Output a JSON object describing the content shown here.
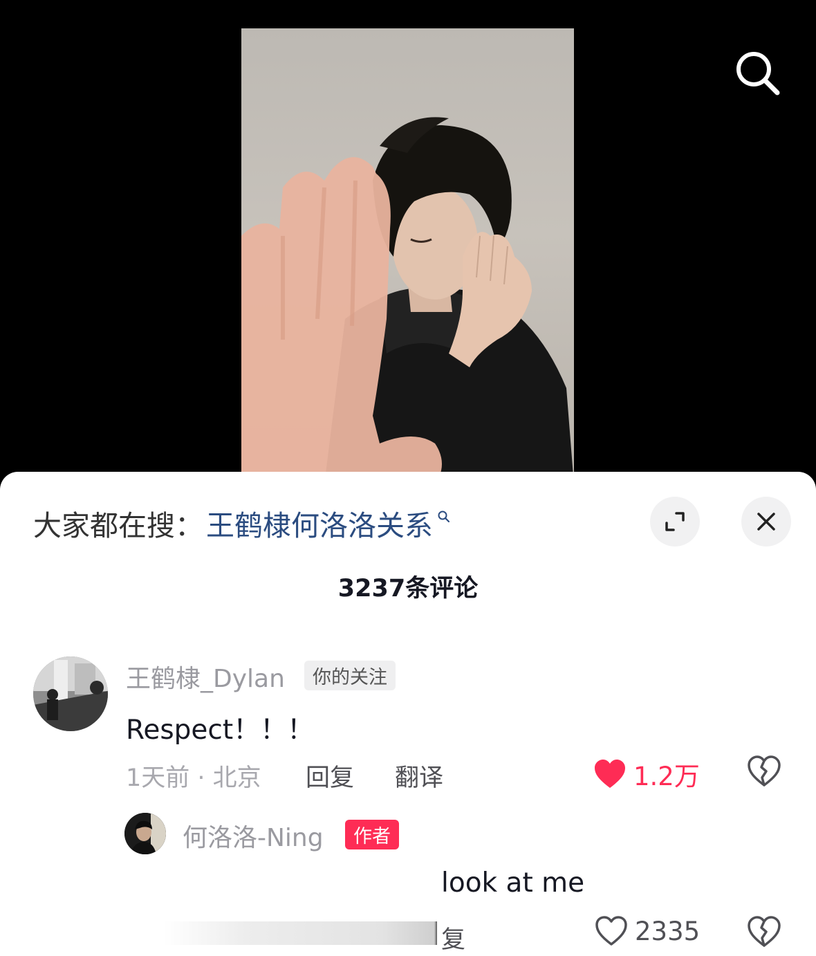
{
  "search_suggest": {
    "prefix": "大家都在搜：",
    "term": "王鹤棣何洛洛关系"
  },
  "comment_count": "3237条评论",
  "comments": [
    {
      "username": "王鹤棣_Dylan",
      "tag": "你的关注",
      "text": "Respect！！！",
      "time_location": "1天前 · 北京",
      "reply_label": "回复",
      "translate_label": "翻译",
      "likes": "1.2万",
      "liked": true,
      "replies": [
        {
          "username": "何洛洛-Ning",
          "tag": "作者",
          "text": "look at me",
          "reply_label_partial": "复",
          "likes": "2335",
          "liked": false
        }
      ]
    }
  ],
  "colors": {
    "accent": "#fe2c55",
    "search_term": "#2b4c80",
    "muted_text": "#9a9aa0"
  },
  "icons": [
    "search-icon",
    "expand-icon",
    "close-icon",
    "heart-filled-icon",
    "heart-outline-icon",
    "broken-heart-icon",
    "small-search-icon"
  ]
}
